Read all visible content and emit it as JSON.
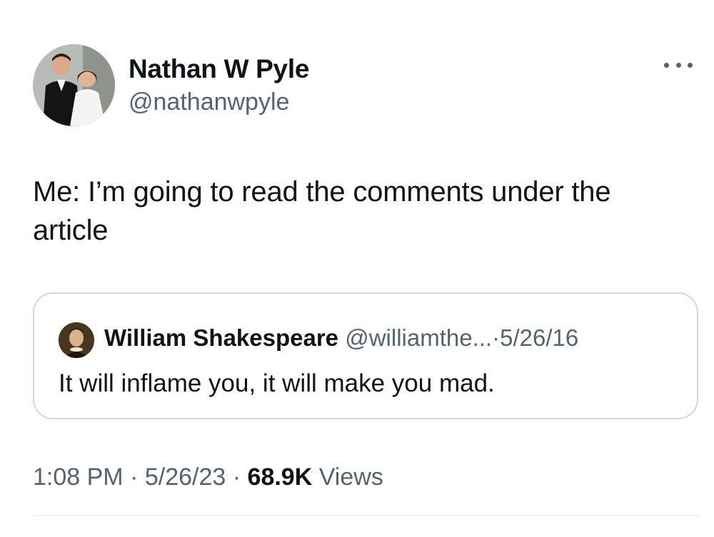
{
  "author": {
    "name": "Nathan W Pyle",
    "handle": "@nathanwpyle",
    "avatar_icon": "profile-photo-couple"
  },
  "tweet": {
    "text": "Me: I’m going to read the comments under the article"
  },
  "quote": {
    "name": "William Shakespeare",
    "handle": "@williamthe...",
    "separator": "·",
    "date": "5/26/16",
    "text": "It will inflame you, it will make you mad.",
    "avatar_icon": "shakespeare-portrait"
  },
  "meta": {
    "time": "1:08 PM",
    "sep1": "·",
    "date": "5/26/23",
    "sep2": "·",
    "views_count": "68.9K",
    "views_label": "Views"
  },
  "icons": {
    "more": "more-options-icon"
  },
  "colors": {
    "text_primary": "#0f1419",
    "text_secondary": "#536471",
    "border": "#cfd9de"
  }
}
